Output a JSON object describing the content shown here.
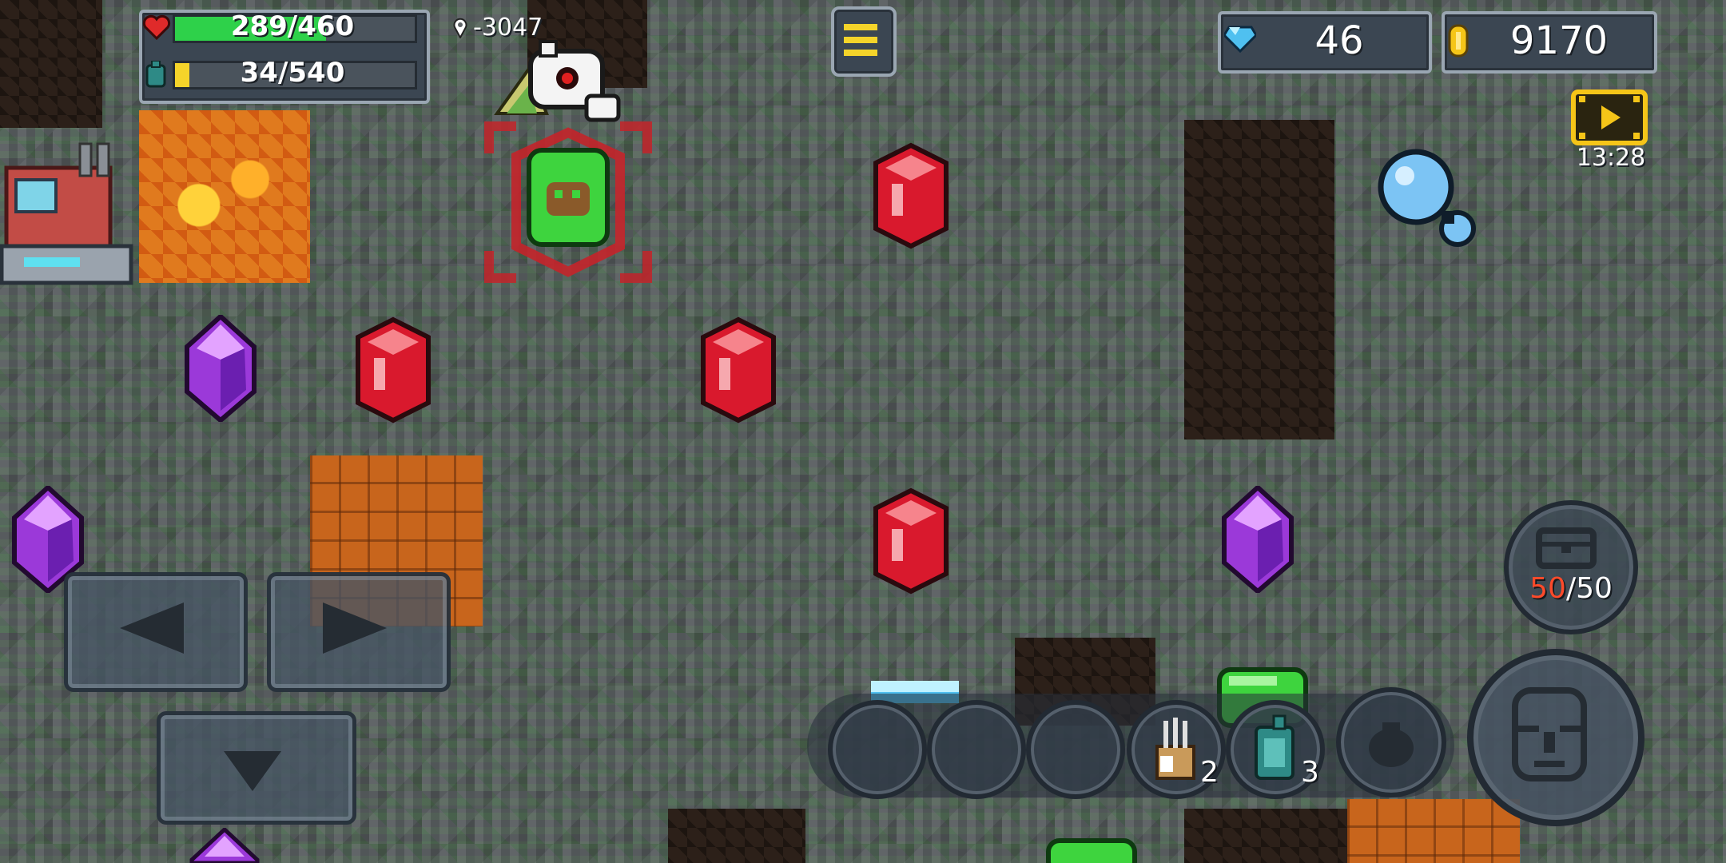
{
  "hud": {
    "health": {
      "current": 289,
      "max": 460,
      "text": "289/460",
      "fill_fraction": 0.63,
      "color": "#2ed14a"
    },
    "fuel": {
      "current": 34,
      "max": 540,
      "text": "34/540",
      "fill_fraction": 0.06,
      "color": "#f5d42a"
    },
    "depth_text": "-3047",
    "gems_text": "46",
    "coins_text": "9170",
    "timer_text": "13:28"
  },
  "inventory": {
    "used": "50",
    "capacity": "/50",
    "used_color": "#ff4a2a"
  },
  "items": [
    {
      "name": "empty-slot"
    },
    {
      "name": "empty-slot"
    },
    {
      "name": "empty-slot"
    },
    {
      "name": "dynamite-pack",
      "count": "2"
    },
    {
      "name": "fuel-canister",
      "count": "3"
    },
    {
      "name": "bag-slot"
    }
  ],
  "colors": {
    "ruby": "#d9192d",
    "amethyst": "#9b39d9",
    "emerald": "#3ed43e",
    "accent_gold": "#f5c518"
  }
}
